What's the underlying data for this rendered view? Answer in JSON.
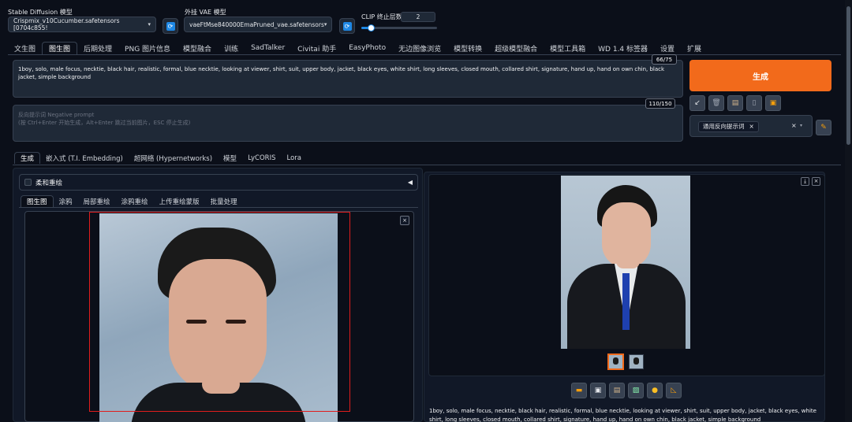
{
  "header": {
    "sd_model_label": "Stable Diffusion 模型",
    "sd_model_value": "Crispmix_v10Cucumber.safetensors [0704c855!",
    "vae_label": "外挂 VAE 模型",
    "vae_value": "vaeFtMse840000EmaPruned_vae.safetensors",
    "clip_label": "CLIP 终止层数",
    "clip_value": "2",
    "clip_fraction": 0.12
  },
  "main_tabs": [
    "文生图",
    "图生图",
    "后期处理",
    "PNG 图片信息",
    "模型融合",
    "训练",
    "SadTalker",
    "Civitai 助手",
    "EasyPhoto",
    "无边图像浏览",
    "模型转换",
    "超级模型融合",
    "模型工具箱",
    "WD 1.4 标签器",
    "设置",
    "扩展"
  ],
  "active_main_tab": 1,
  "prompt": {
    "text": "1boy, solo, male focus, necktie, black hair, realistic, formal, blue necktie, looking at viewer, shirt, suit, upper body, jacket, black eyes, white shirt, long sleeves, closed mouth, collared shirt, signature, hand up, hand on own chin, black jacket, simple background",
    "counter": "66/75"
  },
  "negative_prompt": {
    "placeholder_line1": "反向提示词 Negative prompt",
    "placeholder_line2": "(按 Ctrl+Enter 开始生成，Alt+Enter 跳过当前图片，ESC 停止生成)",
    "counter": "110/150"
  },
  "generate": {
    "label": "生成",
    "accent": "#f26a1b"
  },
  "style_select": {
    "chip": "通用反向提示词"
  },
  "sub_tabs": [
    "生成",
    "嵌入式 (T.I. Embedding)",
    "超网络 (Hypernetworks)",
    "模型",
    "LyCORIS",
    "Lora"
  ],
  "active_sub_tab": 0,
  "soft_inpaint": {
    "label": "柔和重绘"
  },
  "img_tabs": [
    "图生图",
    "涂鸦",
    "局部重绘",
    "涂鸦重绘",
    "上传重绘蒙版",
    "批量处理"
  ],
  "active_img_tab": 0,
  "output_caption": "1boy, solo, male focus, necktie, black hair, realistic, formal, blue necktie, looking at viewer, shirt, suit, upper body, jacket, black eyes, white shirt, long sleeves, closed mouth, collared shirt, signature, hand up, hand on own chin, black jacket, simple background",
  "icons": [
    "refresh-icon",
    "arrow-icon",
    "trash-icon",
    "clipboard-icon",
    "save-icon",
    "folder-icon",
    "image-icon",
    "palette-icon",
    "ruler-icon",
    "close-icon",
    "pencil-icon"
  ]
}
